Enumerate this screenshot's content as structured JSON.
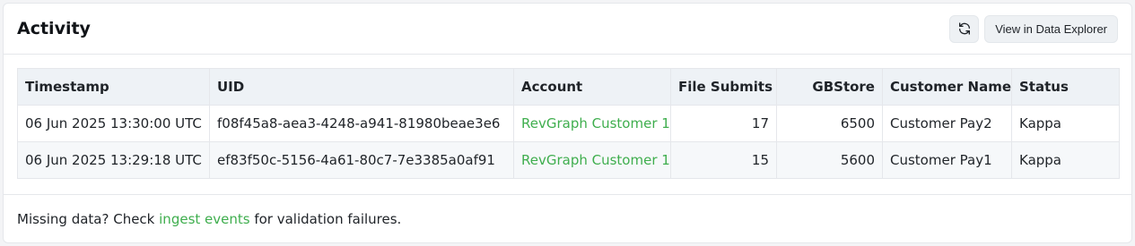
{
  "title": "Activity",
  "actions": {
    "refresh_icon": "refresh-icon",
    "explorer_label": "View in Data Explorer"
  },
  "table": {
    "headers": [
      "Timestamp",
      "UID",
      "Account",
      "File Submits",
      "GBStore",
      "Customer Name",
      "Status"
    ],
    "rows": [
      [
        "06 Jun 2025 13:30:00 UTC",
        "f08f45a8-aea3-4248-a941-81980beae3e6",
        "RevGraph Customer 1",
        "17",
        "6500",
        "Customer Pay2",
        "Kappa"
      ],
      [
        "06 Jun 2025 13:29:18 UTC",
        "ef83f50c-5156-4a61-80c7-7e3385a0af91",
        "RevGraph Customer 1",
        "15",
        "5600",
        "Customer Pay1",
        "Kappa"
      ]
    ]
  },
  "footer": {
    "prefix": "Missing data? Check ",
    "link": "ingest events",
    "suffix": " for validation failures."
  },
  "colors": {
    "link": "#3fae4e",
    "header_bg": "#eef2f6"
  }
}
